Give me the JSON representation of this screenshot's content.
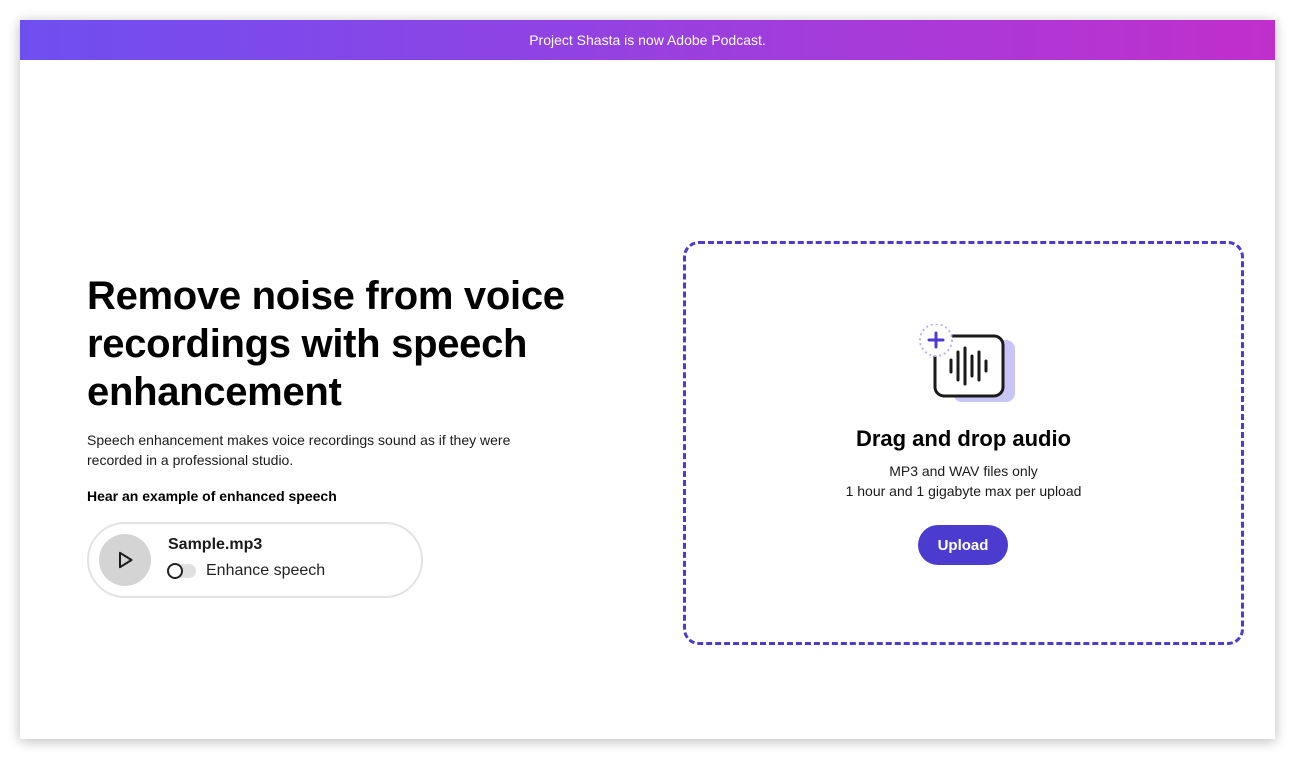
{
  "banner": {
    "text": "Project Shasta is now Adobe Podcast."
  },
  "hero": {
    "headline": "Remove noise from voice recordings with speech enhancement",
    "description": "Speech enhancement makes voice recordings sound as if they were recorded in a professional studio.",
    "example_label": "Hear an example of enhanced speech"
  },
  "player": {
    "file_name": "Sample.mp3",
    "toggle_label": "Enhance speech",
    "toggle_on": false,
    "play_icon": "play-icon"
  },
  "dropzone": {
    "icon": "audio-waveform-add-icon",
    "title": "Drag and drop audio",
    "line1": "MP3 and WAV files only",
    "line2": "1 hour and 1 gigabyte max per upload",
    "upload_label": "Upload"
  },
  "colors": {
    "accent": "#4b3ccf",
    "banner_start": "#6f4ef0",
    "banner_end": "#c02fcc",
    "icon_back_card": "#c9c4f7"
  }
}
